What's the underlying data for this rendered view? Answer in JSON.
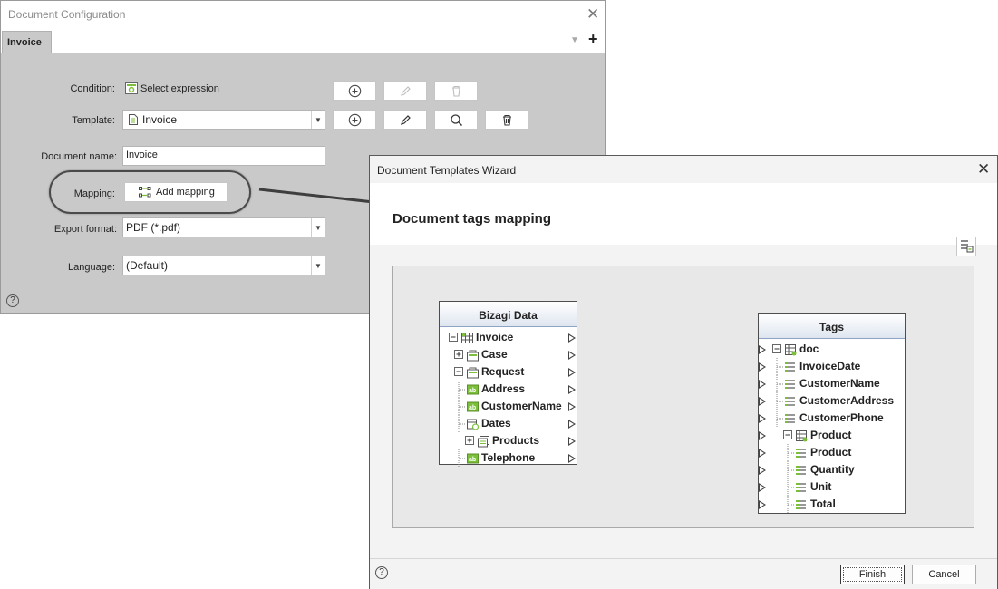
{
  "config_dialog": {
    "title": "Document Configuration",
    "tab_label": "Invoice",
    "condition_label": "Condition:",
    "condition_value": "Select expression",
    "template_label": "Template:",
    "template_value": "Invoice",
    "document_name_label": "Document name:",
    "document_name_value": "Invoice",
    "mapping_label": "Mapping:",
    "mapping_button": "Add mapping",
    "export_format_label": "Export format:",
    "export_format_value": "PDF (*.pdf)",
    "language_label": "Language:",
    "language_value": "(Default)",
    "help_glyph": "?"
  },
  "wizard": {
    "title": "Document Templates Wizard",
    "section_title": "Document tags mapping",
    "bizagi_panel": {
      "header": "Bizagi Data",
      "items": [
        {
          "label": "Invoice",
          "icon": "entity-table-icon"
        },
        {
          "label": "Case",
          "icon": "folder-entity-icon"
        },
        {
          "label": "Request",
          "icon": "folder-entity-icon"
        },
        {
          "label": "Address",
          "icon": "text-attribute-icon"
        },
        {
          "label": "CustomerName",
          "icon": "text-attribute-icon"
        },
        {
          "label": "Dates",
          "icon": "date-attribute-icon"
        },
        {
          "label": "Products",
          "icon": "collection-icon"
        },
        {
          "label": "Telephone",
          "icon": "text-attribute-icon"
        }
      ]
    },
    "tags_panel": {
      "header": "Tags",
      "items": [
        {
          "label": "doc",
          "icon": "doc-table-icon"
        },
        {
          "label": "InvoiceDate",
          "icon": "tag-icon"
        },
        {
          "label": "CustomerName",
          "icon": "tag-icon"
        },
        {
          "label": "CustomerAddress",
          "icon": "tag-icon"
        },
        {
          "label": "CustomerPhone",
          "icon": "tag-icon"
        },
        {
          "label": "Product",
          "icon": "tag-table-icon"
        },
        {
          "label": "Product",
          "icon": "tag-icon"
        },
        {
          "label": "Quantity",
          "icon": "tag-icon"
        },
        {
          "label": "Unit",
          "icon": "tag-icon"
        },
        {
          "label": "Total",
          "icon": "tag-icon"
        }
      ]
    },
    "finish_button": "Finish",
    "cancel_button": "Cancel",
    "help_glyph": "?"
  },
  "colors": {
    "dialog_background": "#c9c9c9",
    "panel_header_gradient_end": "#dfe6f0",
    "icon_green": "#7cbf3a"
  }
}
